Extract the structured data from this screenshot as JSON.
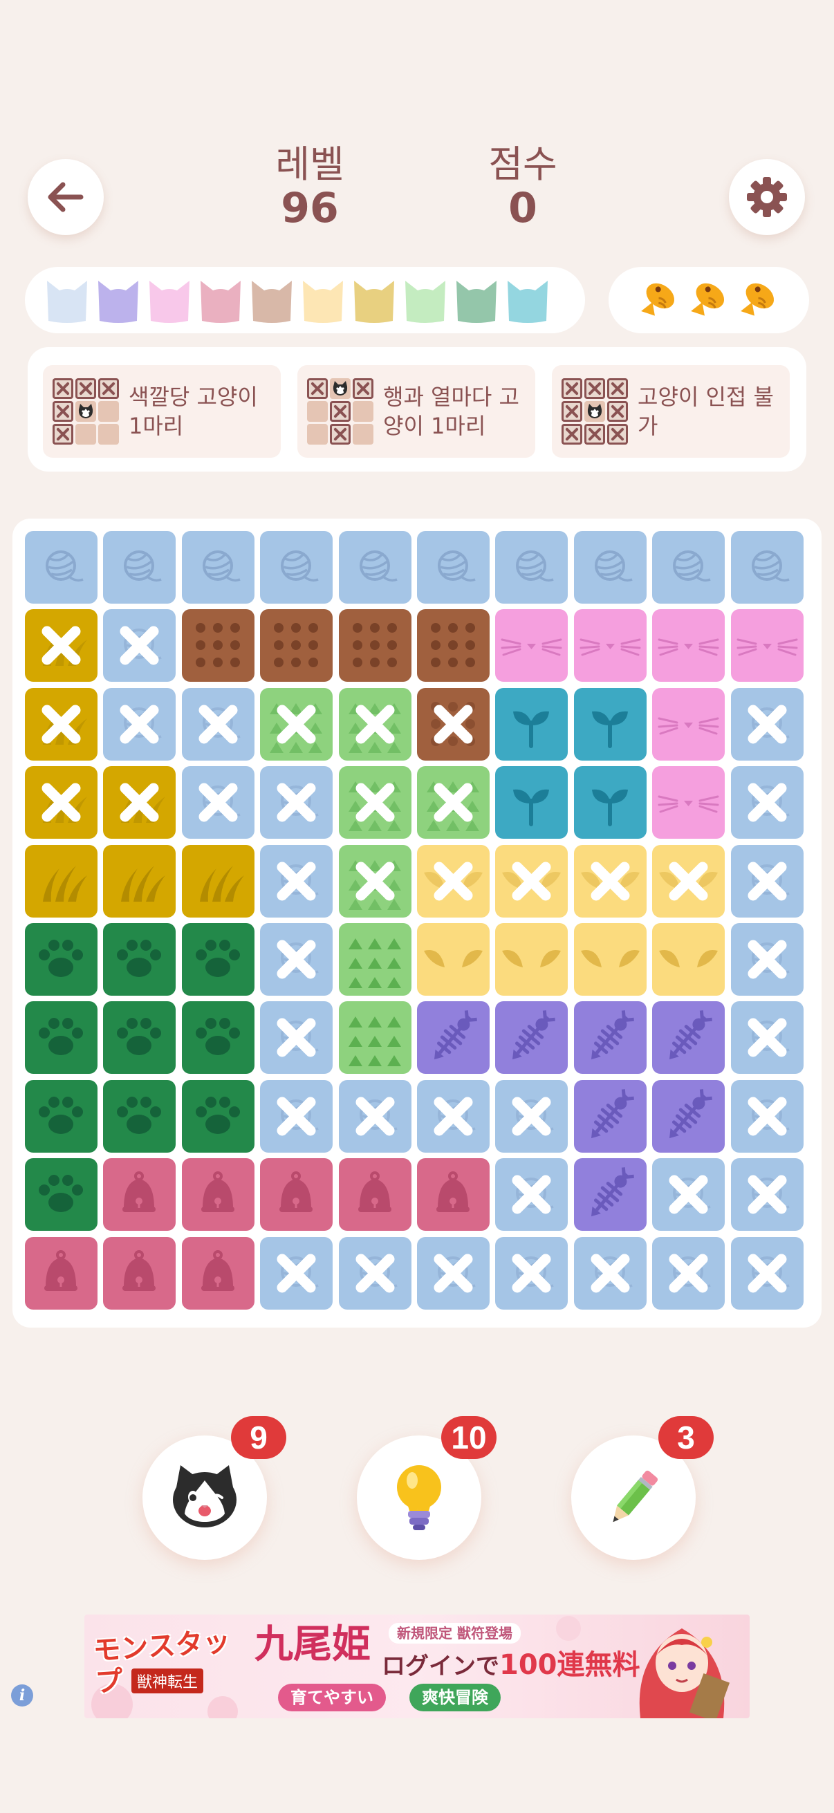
{
  "header": {
    "level_label": "레벨",
    "level_value": "96",
    "score_label": "점수",
    "score_value": "0",
    "back_icon": "arrow-left-icon",
    "settings_icon": "gear-icon"
  },
  "palette": {
    "cat_colors": [
      "#d8e4f4",
      "#bcb2ec",
      "#f8c8ea",
      "#eab0c0",
      "#d8b8a8",
      "#fde6b4",
      "#e8d080",
      "#c4ecc0",
      "#94c6aa",
      "#94d6e0"
    ],
    "lives": 3,
    "life_icon": "fish-icon",
    "life_color": "#f6a818"
  },
  "rules": [
    {
      "text": "색깔당 고양이 1마리",
      "icon": "color-rule-icon"
    },
    {
      "text": "행과 열마다 고양이 1마리",
      "icon": "row-column-rule-icon"
    },
    {
      "text": "고양이 인접 불가",
      "icon": "adjacency-rule-icon"
    }
  ],
  "board": {
    "size": 10,
    "regions": {
      "B": {
        "color": "#a5c5e6",
        "pattern": "yarn"
      },
      "Y": {
        "color": "#d4a700",
        "pattern": "grass"
      },
      "R": {
        "color": "#a0603e",
        "pattern": "dots"
      },
      "P": {
        "color": "#f59fde",
        "pattern": "whiskers"
      },
      "G": {
        "color": "#8ed27e",
        "pattern": "triangles"
      },
      "T": {
        "color": "#3da9c3",
        "pattern": "sprout"
      },
      "O": {
        "color": "#fbdb7e",
        "pattern": "ears"
      },
      "D": {
        "color": "#23894a",
        "pattern": "paw"
      },
      "V": {
        "color": "#9180dc",
        "pattern": "fishbone"
      },
      "K": {
        "color": "#d8698a",
        "pattern": "bell"
      }
    },
    "layout": [
      "BBBBBBBBBB",
      "YBRRRRPPPP",
      "YBBGGRTTPB",
      "YYBBGGTTPB",
      "YYYBGOOOOB",
      "DDDBGOOOOB",
      "DDDBGVVVVB",
      "DDDBBBBVVB",
      "DKKKKKBVBB",
      "KKKBBBBBBB"
    ],
    "marks": [
      "..........",
      "XX........",
      "XXXXXX...X",
      "XXXXXX...X",
      "...XXXXXXX",
      "...X.....X",
      "...X.....X",
      "...XXXX..X",
      "......X.XX",
      "...XXXXXXX"
    ]
  },
  "tools": [
    {
      "name": "cat-hint",
      "icon": "cat-face-icon",
      "count": "9"
    },
    {
      "name": "lightbulb-hint",
      "icon": "lightbulb-icon",
      "count": "10"
    },
    {
      "name": "pencil",
      "icon": "pencil-icon",
      "count": "3"
    }
  ],
  "ad": {
    "logo": "モンスタップ",
    "logo_sub": "獣神転生",
    "title": "九尾姫",
    "tagline": "新規限定 獣符登場",
    "promo_prefix": "ログインで",
    "promo_highlight": "100連無料",
    "chip1": "育てやすい",
    "chip2": "爽快冒険",
    "info_icon": "info-icon"
  }
}
